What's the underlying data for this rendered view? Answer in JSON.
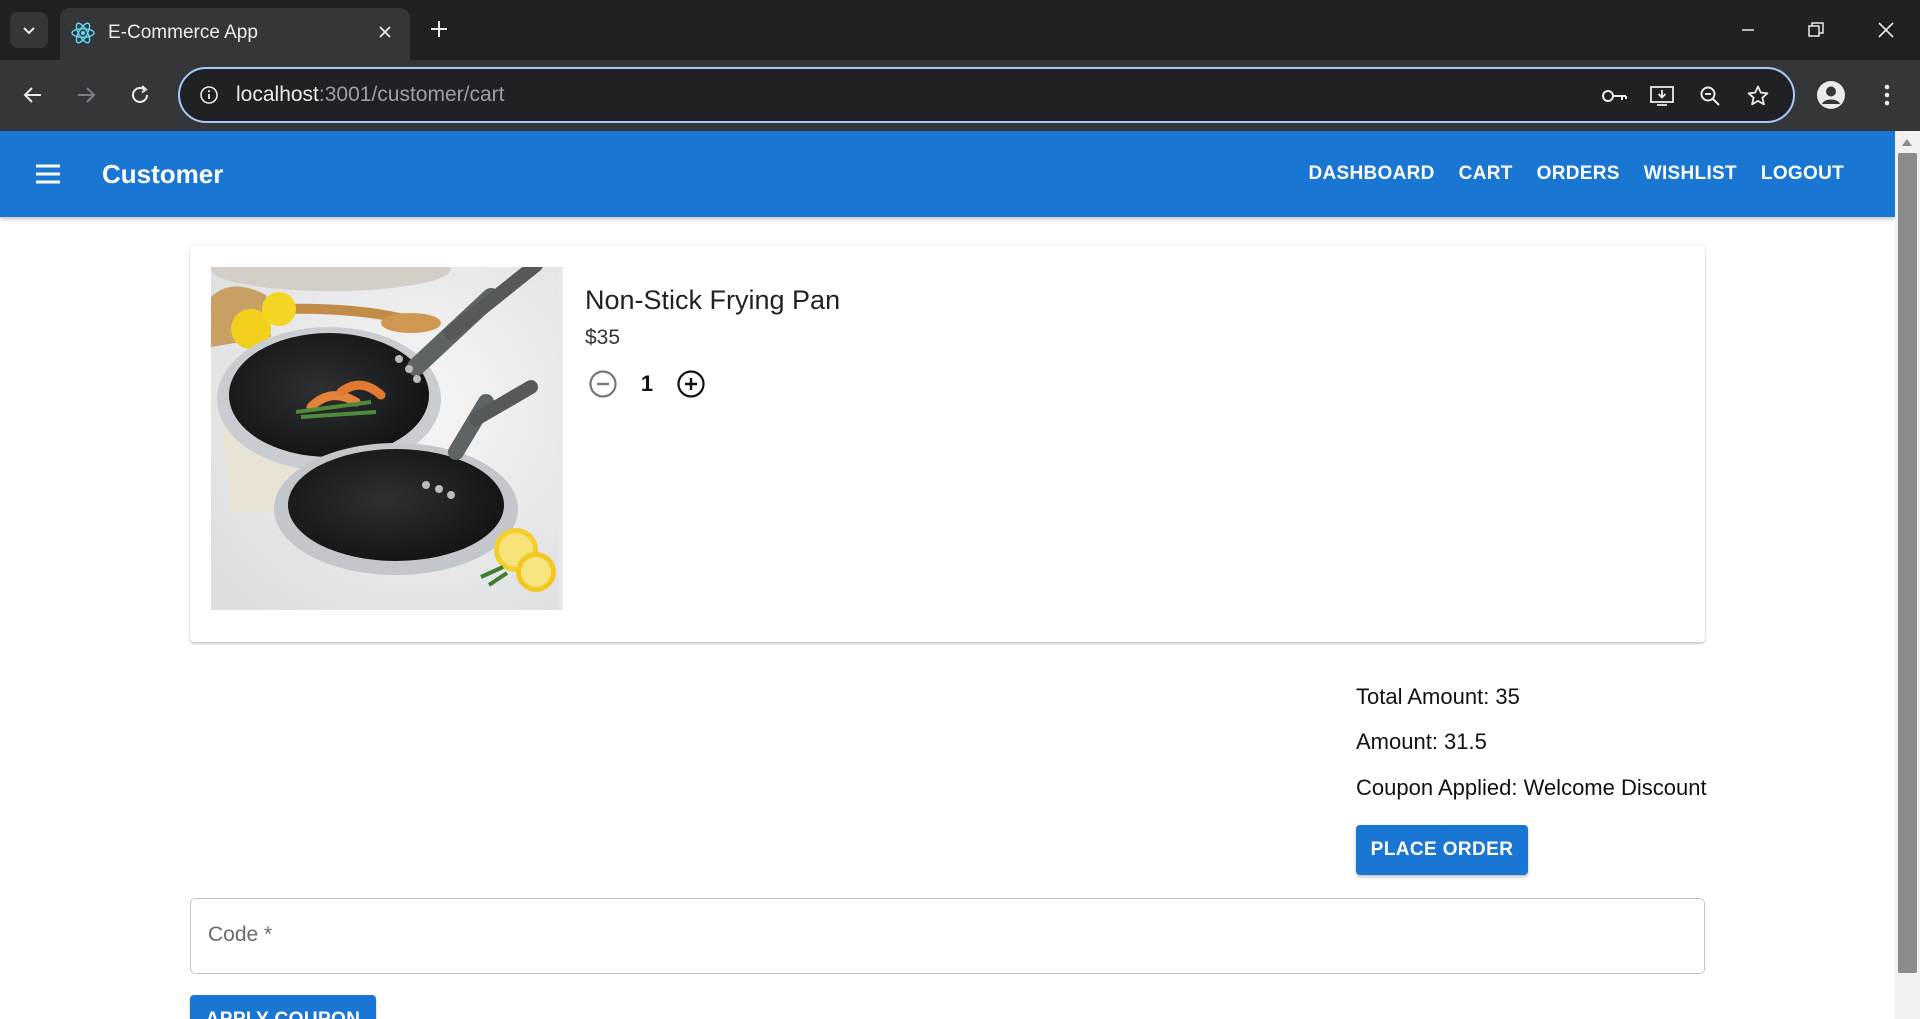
{
  "browser": {
    "tab_title": "E-Commerce App",
    "url_host": "localhost",
    "url_rest": ":3001/customer/cart"
  },
  "appbar": {
    "title": "Customer",
    "nav": [
      "DASHBOARD",
      "CART",
      "ORDERS",
      "WISHLIST",
      "LOGOUT"
    ],
    "color": "#1976d2"
  },
  "cart": {
    "item": {
      "name": "Non-Stick Frying Pan",
      "price": "$35",
      "quantity": "1"
    }
  },
  "summary": {
    "total": "Total Amount: 35",
    "amount": "Amount: 31.5",
    "coupon": "Coupon Applied: Welcome Discount",
    "place_order": "PLACE ORDER"
  },
  "coupon_form": {
    "code_label": "Code *",
    "apply": "APPLY COUPON"
  }
}
